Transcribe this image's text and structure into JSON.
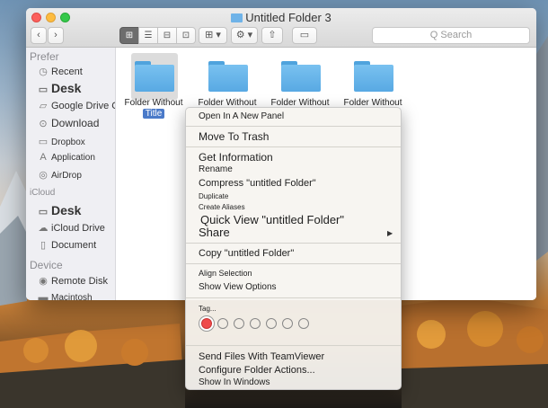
{
  "window": {
    "title": "Untitled Folder 3",
    "search_placeholder": "Q Search"
  },
  "toolbar": {
    "back": "‹",
    "forward": "›",
    "views": [
      "⊞",
      "☰",
      "⊟",
      "⊡"
    ],
    "arrange": "⊞ ▾",
    "action": "⚙ ▾",
    "share": "⇧",
    "tags": "▭"
  },
  "sidebar": {
    "favorites_header": "Prefer",
    "favorites": [
      {
        "label": "Recent",
        "icon": "clock-icon"
      },
      {
        "label": "Desk",
        "icon": "desktop-icon"
      },
      {
        "label": "Google Drive Cartola Without",
        "icon": "google-drive-icon"
      },
      {
        "label": "Download",
        "icon": "download-icon"
      },
      {
        "label": "Dropbox",
        "icon": "folder-icon"
      },
      {
        "label": "Application",
        "icon": "applications-icon"
      },
      {
        "label": "AirDrop",
        "icon": "airdrop-icon"
      }
    ],
    "icloud_header": "iCloud",
    "icloud": [
      {
        "label": "Desk",
        "icon": "desktop-icon"
      },
      {
        "label": "iCloud Drive",
        "icon": "cloud-icon"
      },
      {
        "label": "Document",
        "icon": "document-icon"
      }
    ],
    "devices_header": "Device",
    "devices": [
      {
        "label": "Remote Disk",
        "icon": "disk-icon"
      },
      {
        "label": "Macintosh",
        "icon": "hd-icon"
      }
    ]
  },
  "files": [
    {
      "label": "Folder Without",
      "label2": "Title",
      "selected": true
    },
    {
      "label": "Folder Without",
      "label2": "",
      "selected": false
    },
    {
      "label": "Folder Without",
      "label2": "",
      "selected": false
    },
    {
      "label": "Folder Without",
      "label2": "",
      "selected": false
    }
  ],
  "context_menu": {
    "open_new_panel": "Open In A New Panel",
    "move_to_trash": "Move To Trash",
    "get_information": "Get Information",
    "rename": "Rename",
    "compress": "Compress \"untitled Folder\"",
    "duplicate": "Duplicate",
    "create_aliases": "Create Aliases",
    "quick_view": "Quick View \"untitled Folder\"",
    "share": "Share",
    "copy": "Copy \"untitled Folder\"",
    "align_selection": "Align Selection",
    "show_view_options": "Show View Options",
    "tags": "Tag...",
    "tag_colors": [
      "#ef4a4a",
      "none",
      "none",
      "none",
      "none",
      "none",
      "none"
    ],
    "teamviewer": "Send Files With TeamViewer",
    "folder_actions": "Configure Folder Actions...",
    "show_in_windows": "Show In Windows"
  }
}
